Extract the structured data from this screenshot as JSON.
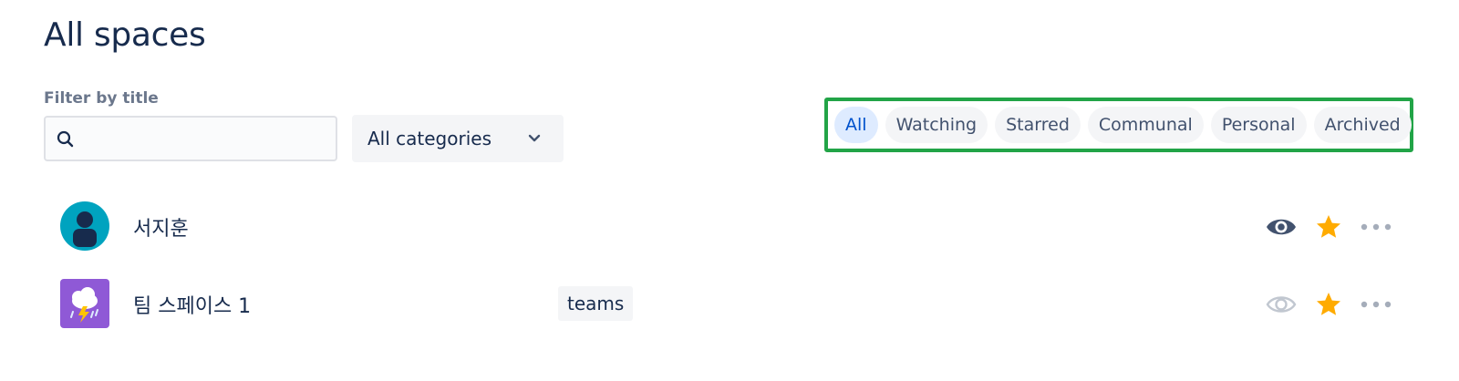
{
  "page": {
    "title": "All spaces"
  },
  "filter": {
    "label": "Filter by title",
    "search_value": "",
    "search_placeholder": "",
    "category_selected": "All categories"
  },
  "tabs": [
    {
      "label": "All",
      "active": true
    },
    {
      "label": "Watching",
      "active": false
    },
    {
      "label": "Starred",
      "active": false
    },
    {
      "label": "Communal",
      "active": false
    },
    {
      "label": "Personal",
      "active": false
    },
    {
      "label": "Archived",
      "active": false
    }
  ],
  "spaces": [
    {
      "name": "서지훈",
      "category": "",
      "avatar_icon": "person-avatar-icon",
      "watching": true,
      "starred": true
    },
    {
      "name": "팀 스페이스 1",
      "category": "teams",
      "avatar_icon": "storm-cloud-avatar-icon",
      "watching": false,
      "starred": true
    }
  ],
  "colors": {
    "accent": "#0052CC",
    "tabs_highlight_border": "#22A447",
    "star": "#FFAB00",
    "eye_active": "#42526E",
    "eye_inactive": "#C1C7D0"
  }
}
